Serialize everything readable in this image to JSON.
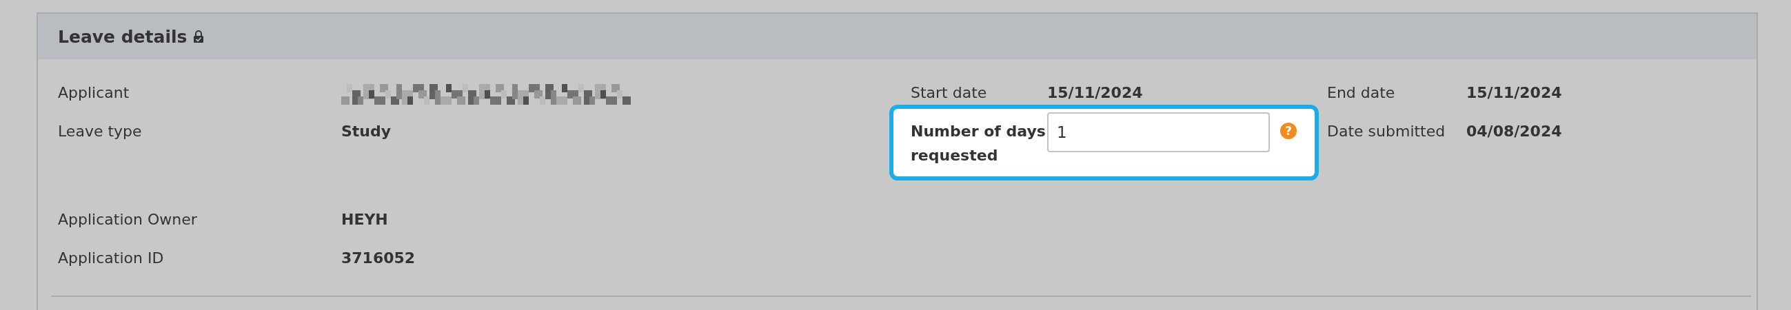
{
  "panel": {
    "title": "Leave details"
  },
  "columns": [
    [
      {
        "kind": "redacted",
        "label": "Applicant"
      },
      {
        "kind": "text",
        "label": "Leave type",
        "value": "Study"
      },
      {
        "kind": "text",
        "label": "Application Owner",
        "value": "HEYH"
      },
      {
        "kind": "text",
        "label": "Application ID",
        "value": "3716052"
      }
    ],
    [
      {
        "kind": "text",
        "label": "Start date",
        "value": "15/11/2024"
      },
      {
        "kind": "input",
        "label": "Number of days requested",
        "value": "1",
        "highlighted": true,
        "help": "?"
      }
    ],
    [
      {
        "kind": "text",
        "label": "End date",
        "value": "15/11/2024"
      },
      {
        "kind": "text",
        "label": "Date submitted",
        "value": "04/08/2024"
      }
    ]
  ]
}
